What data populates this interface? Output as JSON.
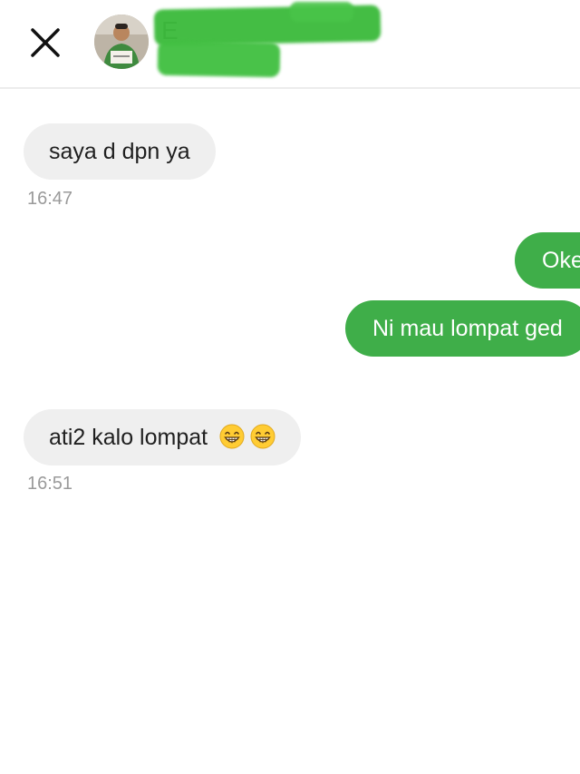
{
  "header": {
    "contact_initial": "E",
    "close_icon": "close-icon"
  },
  "messages": [
    {
      "direction": "incoming",
      "text": "saya d dpn ya",
      "time": "16:47"
    },
    {
      "direction": "outgoing",
      "text": "Oke"
    },
    {
      "direction": "outgoing",
      "text": "Ni mau lompat ged"
    },
    {
      "direction": "incoming",
      "text": "ati2 kalo lompat",
      "emojis": [
        "grinning-face-emoji",
        "grinning-face-emoji"
      ],
      "time": "16:51"
    }
  ],
  "colors": {
    "incoming_bubble": "#efefef",
    "outgoing_bubble": "#3fae49",
    "redaction": "#3dbb3d"
  }
}
